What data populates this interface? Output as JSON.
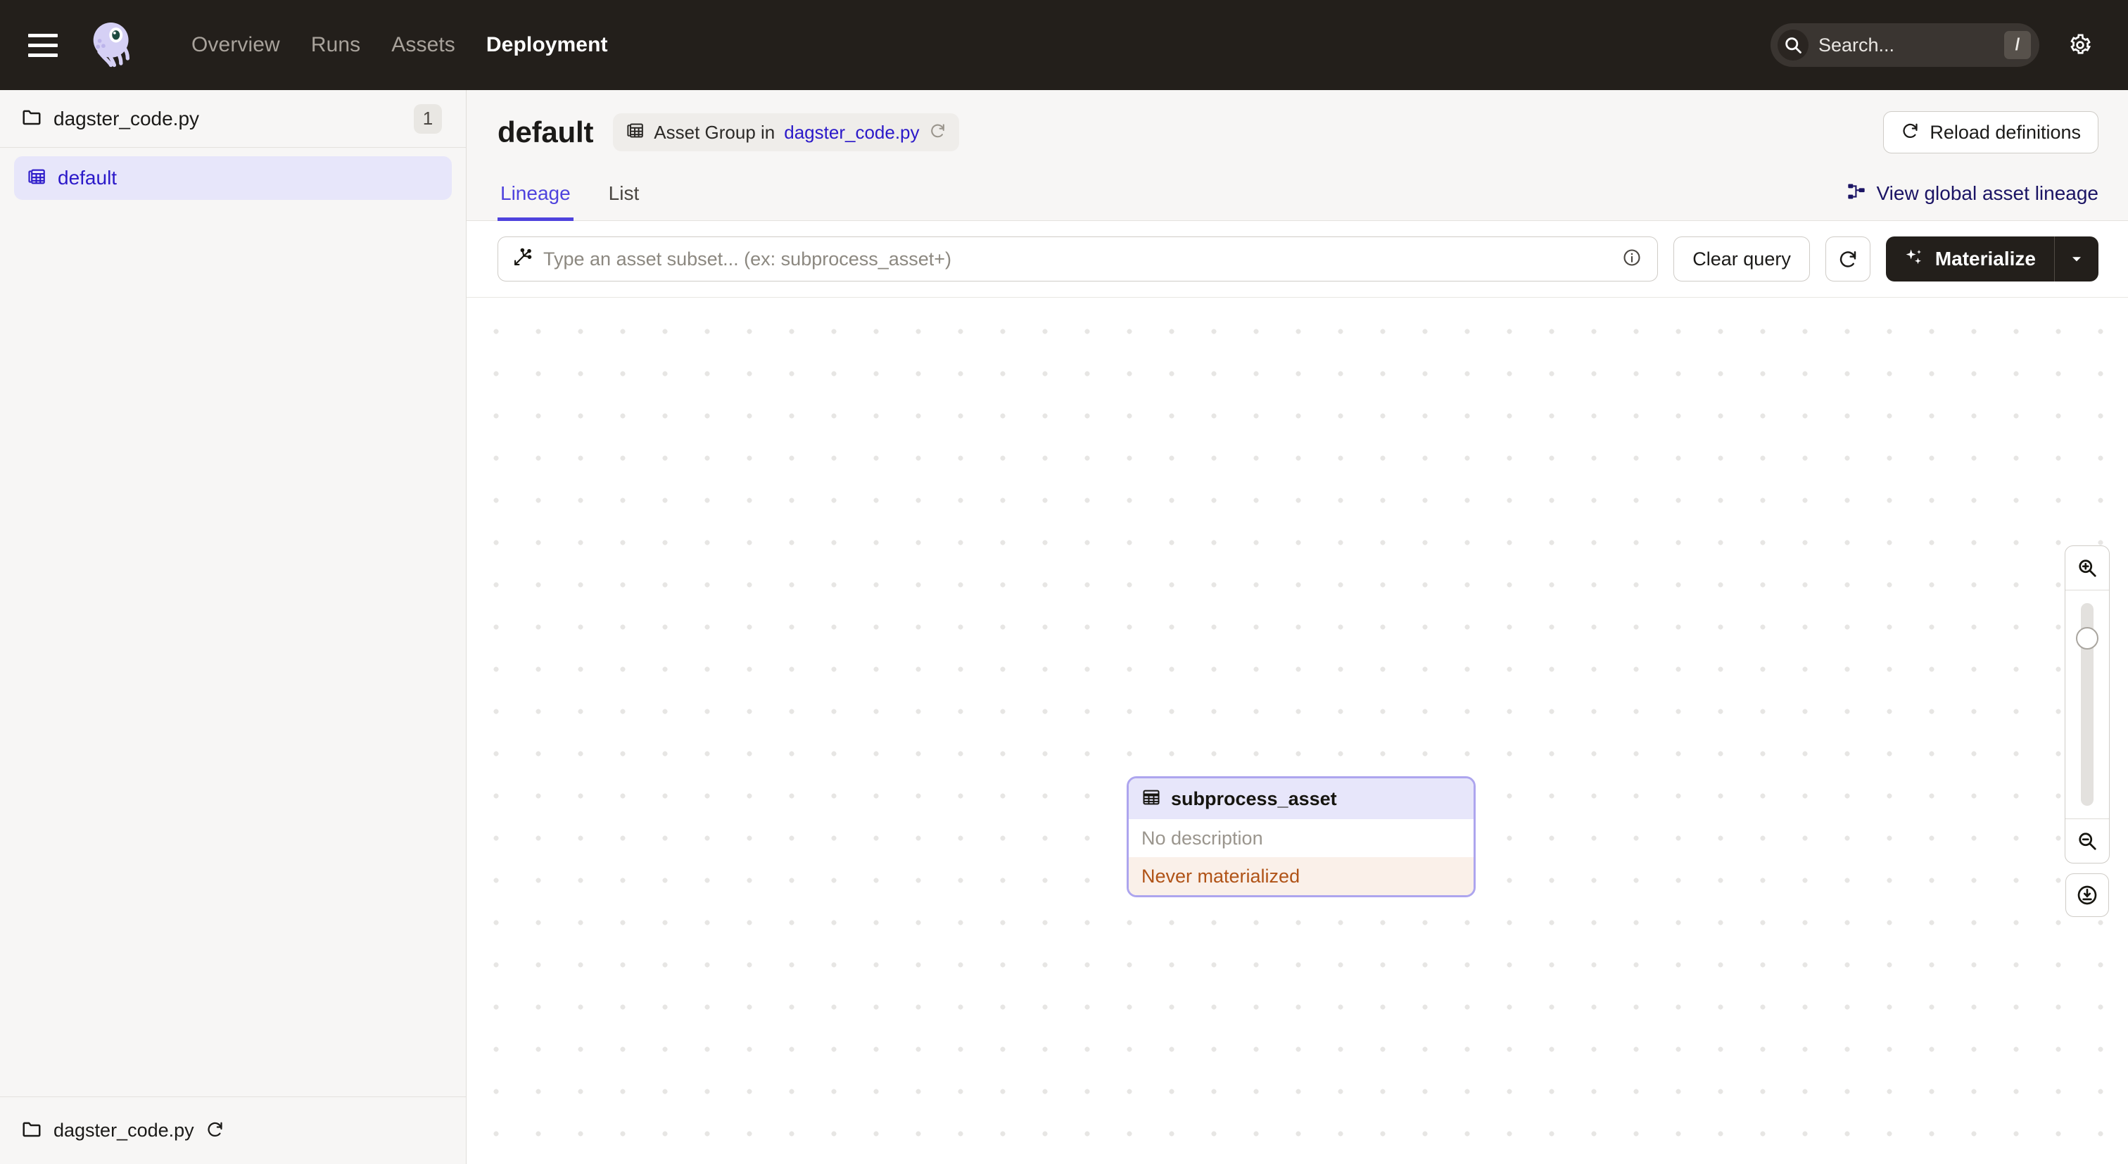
{
  "topnav": {
    "menu_icon": "hamburger-menu-icon",
    "logo_icon": "dagster-logo-icon",
    "links": [
      {
        "label": "Overview",
        "active": false
      },
      {
        "label": "Runs",
        "active": false
      },
      {
        "label": "Assets",
        "active": false
      },
      {
        "label": "Deployment",
        "active": true
      }
    ],
    "search": {
      "placeholder": "Search...",
      "icon": "search-icon",
      "shortcut": "/"
    },
    "settings_icon": "gear-icon"
  },
  "sidebar": {
    "repository": {
      "icon": "folder-icon",
      "name": "dagster_code.py",
      "count": "1"
    },
    "groups": [
      {
        "icon": "asset-group-icon",
        "label": "default",
        "selected": true
      }
    ],
    "footer": {
      "icon": "folder-icon",
      "name": "dagster_code.py",
      "reload_icon": "reload-icon"
    }
  },
  "header": {
    "title": "default",
    "group_pill": {
      "icon": "asset-group-icon",
      "text": "Asset Group in",
      "link": "dagster_code.py",
      "reload_icon": "reload-icon"
    },
    "reload_definitions": {
      "icon": "reload-icon",
      "label": "Reload definitions"
    }
  },
  "tabs": [
    {
      "label": "Lineage",
      "active": true
    },
    {
      "label": "List",
      "active": false
    }
  ],
  "global_lineage": {
    "icon": "lineage-tree-icon",
    "label": "View global asset lineage"
  },
  "query_bar": {
    "selection_icon": "asset-selection-icon",
    "placeholder": "Type an asset subset... (ex: subprocess_asset+)",
    "info_icon": "info-circle-icon",
    "clear_query_label": "Clear query",
    "refresh_icon": "refresh-icon",
    "materialize": {
      "icon": "sparkle-icon",
      "label": "Materialize",
      "caret_icon": "chevron-down-icon"
    }
  },
  "graph": {
    "nodes": [
      {
        "icon": "asset-table-icon",
        "name": "subprocess_asset",
        "description": "No description",
        "status": "Never materialized"
      }
    ]
  },
  "zoom_controls": {
    "zoom_in_icon": "zoom-in-icon",
    "zoom_out_icon": "zoom-out-icon",
    "fit_icon": "zoom-to-fit-icon"
  },
  "colors": {
    "nav_bg": "#231F1B",
    "accent": "#4F43DD",
    "link": "#2B19C9",
    "node_border": "#ADA5EE",
    "node_head": "#E7E6FA",
    "status_bg": "#FAF0E9",
    "status_text": "#B05317",
    "sidebar_bg": "#F7F6F5"
  }
}
